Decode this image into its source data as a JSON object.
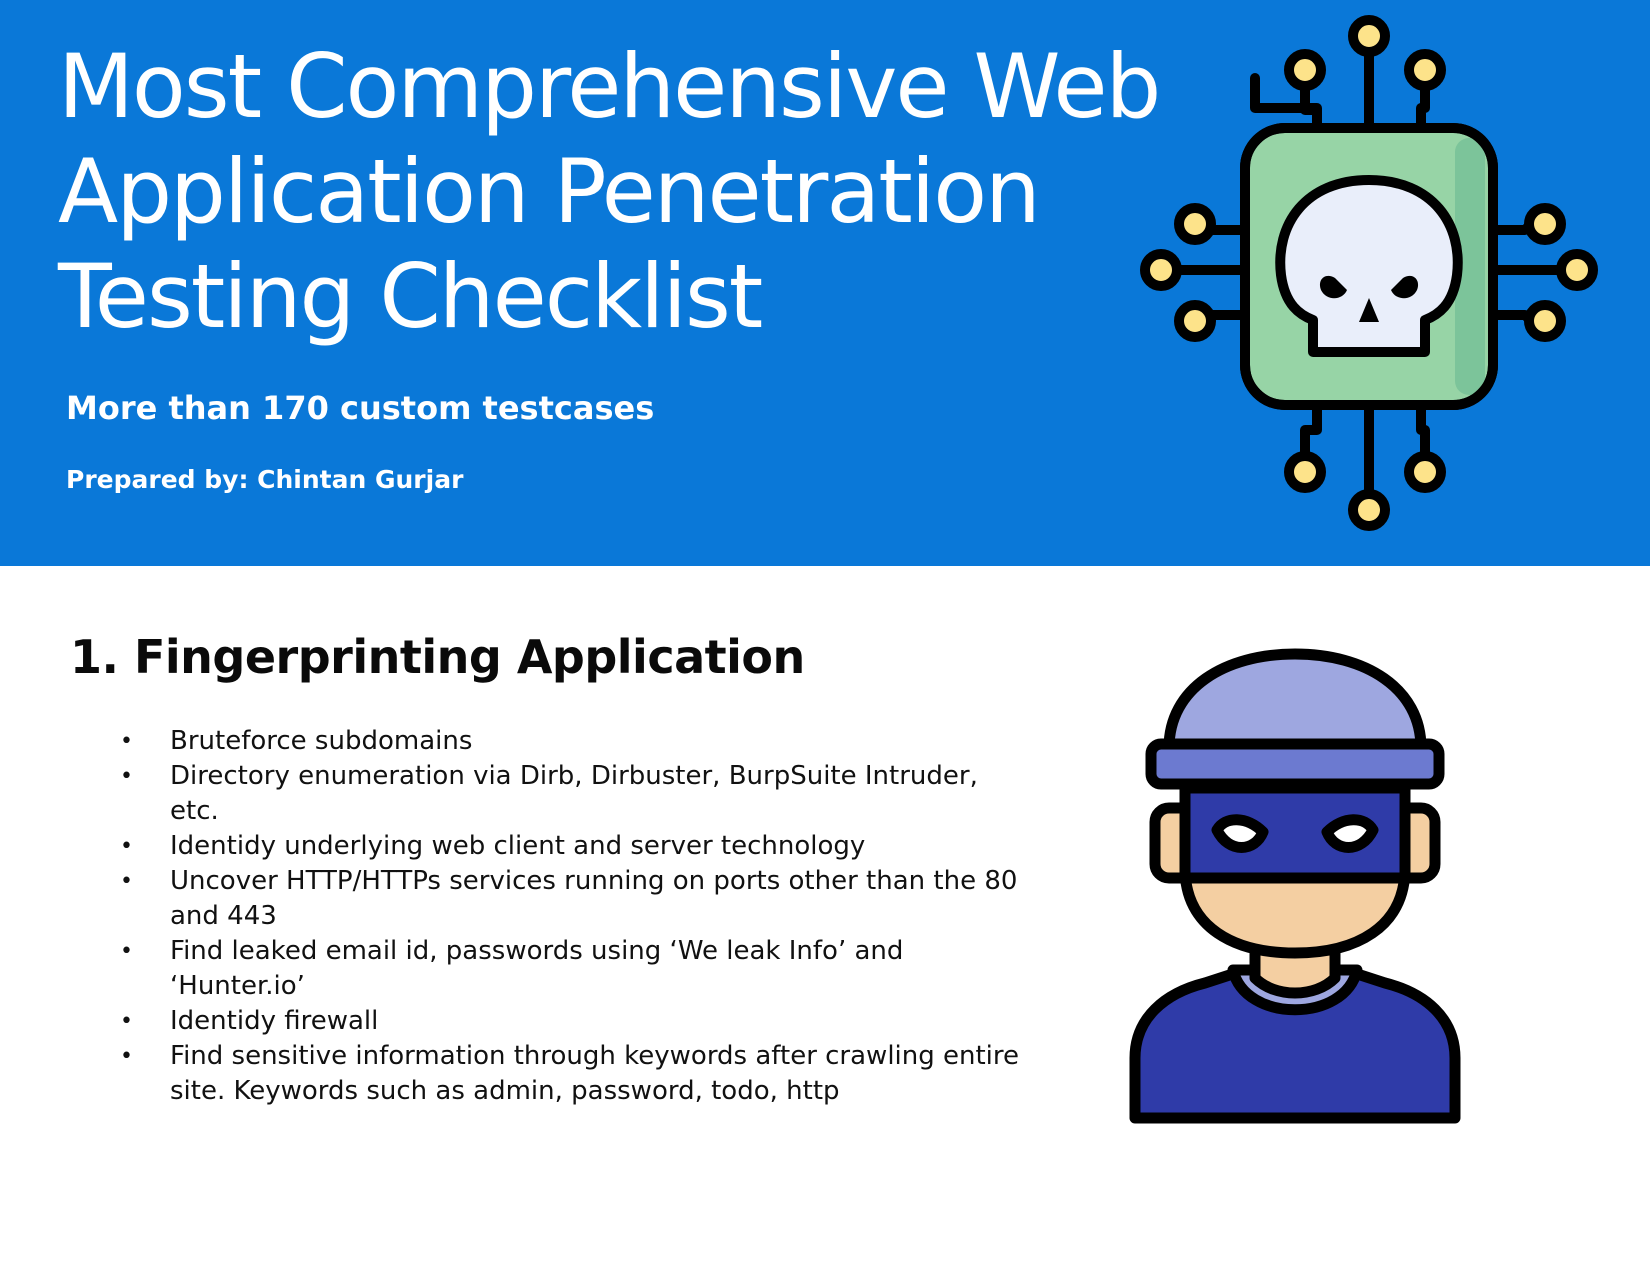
{
  "banner": {
    "title_lines": [
      "Most Comprehensive Web",
      "Application Penetration",
      "Testing Checklist"
    ],
    "subtitle": "More than 170 custom testcases",
    "prepared_by": "Prepared by: Chintan Gurjar",
    "icon": "chip-skull-icon"
  },
  "section": {
    "heading": "1. Fingerprinting Application",
    "bullet_char": "•",
    "items": [
      "Bruteforce subdomains",
      "Directory enumeration via Dirb, Dirbuster, BurpSuite Intruder, etc.",
      "Identidy underlying web client and server technology",
      "Uncover HTTP/HTTPs services running on ports other than the 80 and 443",
      "Find leaked email id, passwords using ‘We leak Info’ and ‘Hunter.io’",
      "Identidy firewall",
      "Find sensitive information through keywords after crawling entire site. Keywords such as admin, password, todo, http"
    ],
    "illustration": "hacker-icon"
  },
  "colors": {
    "banner_blue": "#0a78d8",
    "chip_green": "#97d4a6",
    "node_yellow": "#fde38a",
    "hacker_hat": "#9ea7e0",
    "hacker_mask": "#2f3ba8",
    "skin": "#f4cfa2"
  }
}
